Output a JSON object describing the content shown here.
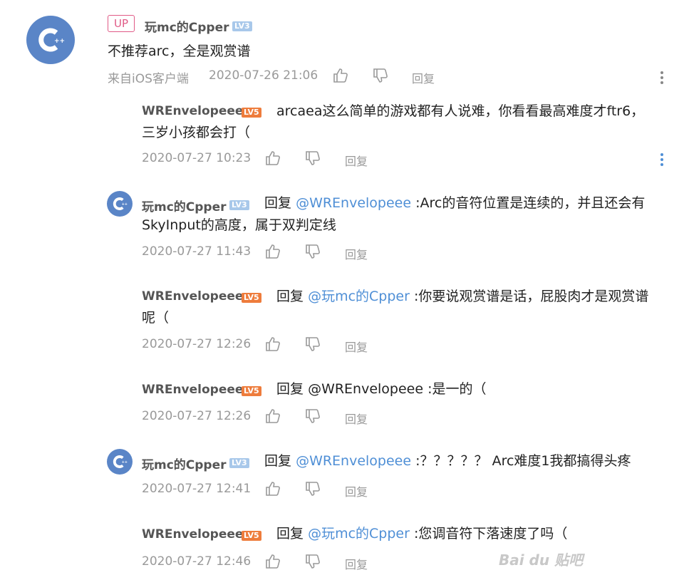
{
  "main_post": {
    "up_badge": "UP",
    "username": "玩mc的Cpper",
    "level": "LV3",
    "content": "不推荐arc，全是观赏谱",
    "source": "来自iOS客户端",
    "time": "2020-07-26 21:06",
    "reply_label": "回复"
  },
  "replies": [
    {
      "username": "WREnvelopeee",
      "level": "LV5",
      "reply_prefix": "",
      "mention": "",
      "sep": "",
      "text": "arcaea这么简单的游戏都有人说难，你看看最高难度才ftr6，",
      "text2": "三岁小孩都会打（",
      "time": "2020-07-27 10:23",
      "reply_label": "回复"
    },
    {
      "username": "玩mc的Cpper",
      "level": "LV3",
      "reply_prefix": "回复",
      "mention": "@WREnvelopeee",
      "text": ":Arc的音符位置是连续的，并且还会有",
      "text2": "SkyInput的高度，属于双判定线",
      "time": "2020-07-27 11:43",
      "reply_label": "回复"
    },
    {
      "username": "WREnvelopeee",
      "level": "LV5",
      "reply_prefix": "回复",
      "mention": "@玩mc的Cpper",
      "text": ":你要说观赏谱是话，屁股肉才是观赏谱",
      "text2": "呢（",
      "time": "2020-07-27 12:26",
      "reply_label": "回复"
    },
    {
      "username": "WREnvelopeee",
      "level": "LV5",
      "reply_prefix": "回复",
      "mention": "@WREnvelopeee",
      "text": ":是一的（",
      "time": "2020-07-27 12:26",
      "reply_label": "回复"
    },
    {
      "username": "玩mc的Cpper",
      "level": "LV3",
      "reply_prefix": "回复",
      "mention": "@WREnvelopeee",
      "text": ":？？？？？ Arc难度1我都搞得头疼",
      "time": "2020-07-27 12:41",
      "reply_label": "回复"
    },
    {
      "username": "WREnvelopeee",
      "level": "LV5",
      "reply_prefix": "回复",
      "mention": "@玩mc的Cpper",
      "text": ":您调音符下落速度了吗（",
      "time": "2020-07-27 12:46",
      "reply_label": "回复"
    }
  ],
  "watermark": "Bai du 贴吧",
  "colors": {
    "link": "#4f8fd6",
    "up_badge": "#e05a86",
    "avatar": "#5a85c7",
    "more_main": "#888888",
    "more_reply": "#4f8fd6"
  },
  "icons": [
    "cpp-avatar-icon",
    "thumb-up-icon",
    "thumb-down-icon",
    "more-vertical-icon",
    "baidu-paw-icon"
  ]
}
